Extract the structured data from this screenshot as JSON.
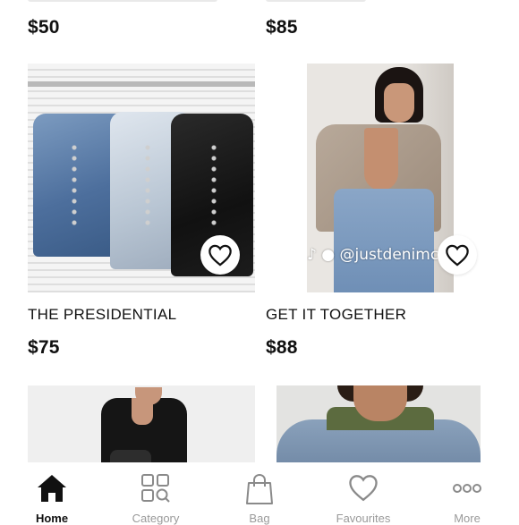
{
  "products_top": [
    {
      "price": "$50"
    },
    {
      "price": "$85"
    }
  ],
  "products_middle": [
    {
      "name": "THE PRESIDENTIAL",
      "price": "$75",
      "favorite_icon": "heart-outline-icon"
    },
    {
      "name": "GET IT TOGETHER",
      "price": "$88",
      "favorite_icon": "heart-outline-icon",
      "watermark": "@justdenimcouture"
    }
  ],
  "nav": {
    "items": [
      {
        "label": "Home",
        "icon": "home-icon",
        "active": true
      },
      {
        "label": "Category",
        "icon": "category-search-icon",
        "active": false
      },
      {
        "label": "Bag",
        "icon": "shopping-bag-icon",
        "active": false
      },
      {
        "label": "Favourites",
        "icon": "heart-icon",
        "active": false
      },
      {
        "label": "More",
        "icon": "more-dots-icon",
        "active": false
      }
    ]
  },
  "colors": {
    "text": "#111111",
    "inactive": "#9a9a9a",
    "background": "#ffffff"
  }
}
